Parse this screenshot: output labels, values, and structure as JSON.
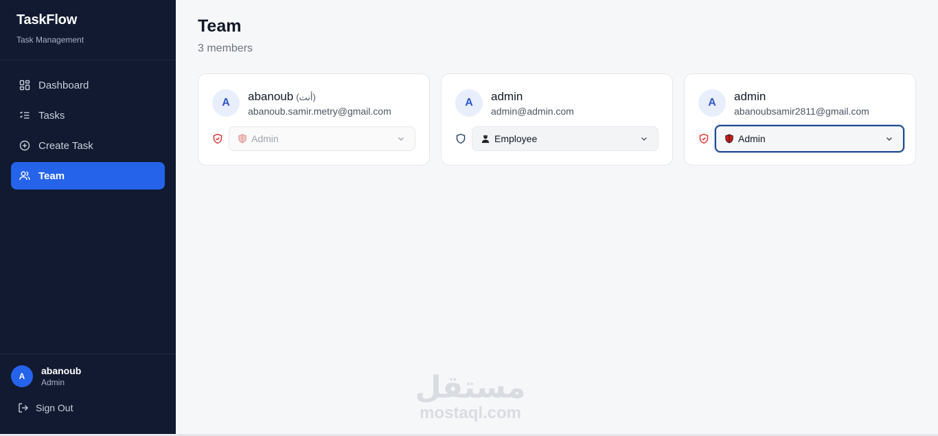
{
  "brand": {
    "title": "TaskFlow",
    "subtitle": "Task Management"
  },
  "nav": {
    "items": [
      {
        "label": "Dashboard",
        "icon": "dashboard-icon"
      },
      {
        "label": "Tasks",
        "icon": "list-icon"
      },
      {
        "label": "Create Task",
        "icon": "plus-circle-icon"
      },
      {
        "label": "Team",
        "icon": "users-icon",
        "active": true
      }
    ]
  },
  "user": {
    "initial": "A",
    "name": "abanoub",
    "role": "Admin",
    "signout_label": "Sign Out"
  },
  "page": {
    "title": "Team",
    "subtitle": "3 members"
  },
  "members": [
    {
      "initial": "A",
      "name": "abanoub",
      "you_tag": "(أنت)",
      "email": "abanoub.samir.metry@gmail.com",
      "role": "Admin",
      "state": "disabled",
      "shield_color": "#dc2626"
    },
    {
      "initial": "A",
      "name": "admin",
      "you_tag": "",
      "email": "admin@admin.com",
      "role": "Employee",
      "state": "enabled",
      "shield_color": "#1e3a5f"
    },
    {
      "initial": "A",
      "name": "admin",
      "you_tag": "",
      "email": "abanoubsamir2811@gmail.com",
      "role": "Admin",
      "state": "focused",
      "shield_color": "#dc2626"
    }
  ],
  "watermark": {
    "arabic": "مستقل",
    "latin": "mostaql.com"
  },
  "colors": {
    "sidebar_bg": "#111a30",
    "accent": "#2563eb",
    "danger": "#dc2626"
  }
}
